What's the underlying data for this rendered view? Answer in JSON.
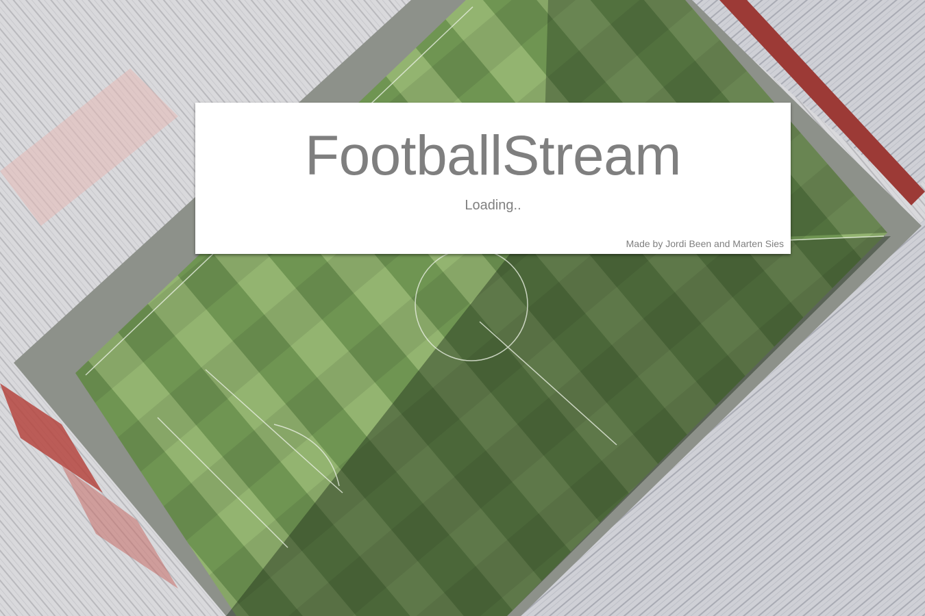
{
  "app": {
    "title": "FootballStream",
    "status": "Loading..",
    "credit": "Made by Jordi Been and Marten Sies"
  },
  "colors": {
    "text": "#7f7f7f",
    "card": "#ffffff",
    "pitch_light": "#8fb069",
    "pitch_dark": "#3f5f34",
    "roof": "#d6d6d8",
    "seats": "#b5453f"
  }
}
